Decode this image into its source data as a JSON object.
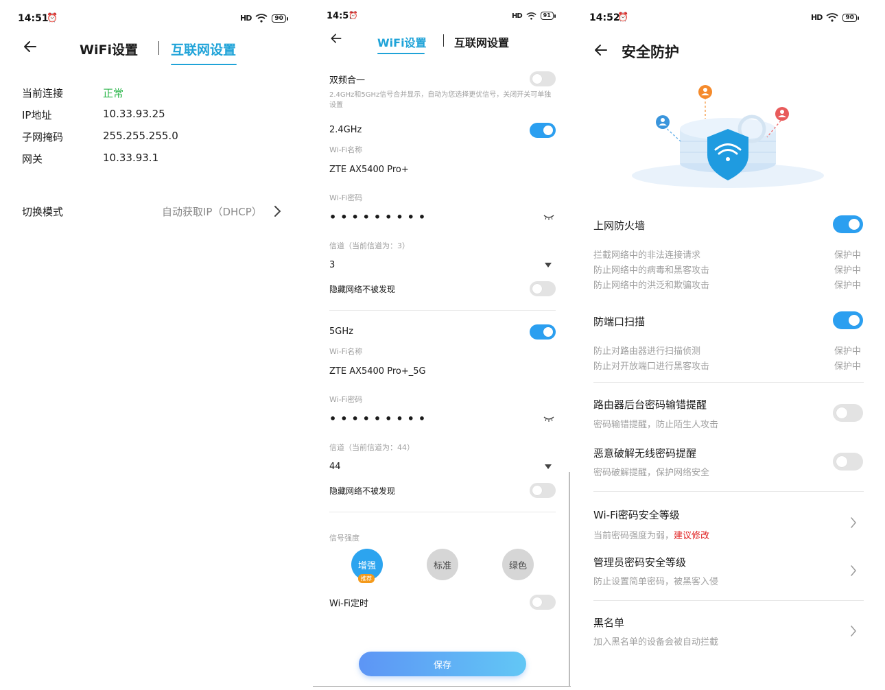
{
  "colors": {
    "accent": "#1fa3d8",
    "toggle_on": "#2b9ff0",
    "ok_green": "#2cb64b",
    "warn_red": "#e02020"
  },
  "p1": {
    "status": {
      "time": "14:51",
      "signal": "HD",
      "battery": "90"
    },
    "tabs": {
      "wifi": "WiFi设置",
      "internet": "互联网设置"
    },
    "info": [
      {
        "label": "当前连接",
        "value": "正常"
      },
      {
        "label": "IP地址",
        "value": "10.33.93.25"
      },
      {
        "label": "子网掩码",
        "value": "255.255.255.0"
      },
      {
        "label": "网关",
        "value": "10.33.93.1"
      }
    ],
    "mode": {
      "label": "切换模式",
      "value": "自动获取IP（DHCP）"
    }
  },
  "p2": {
    "status": {
      "time": "14:51",
      "signal": "HD",
      "battery": "91"
    },
    "tabs": {
      "wifi": "WiFi设置",
      "internet": "互联网设置"
    },
    "dual": {
      "label": "双频合一",
      "desc": "2.4GHz和5GHz信号合并显示，自动为您选择更优信号，关闭开关可单独设置",
      "enabled": false
    },
    "band24": {
      "label": "2.4GHz",
      "enabled": true,
      "name_label": "Wi-Fi名称",
      "name": "ZTE AX5400 Pro+",
      "pwd_label": "Wi-Fi密码",
      "pwd": "•••••••••",
      "channel_label": "信道（当前信道为：3）",
      "channel": "3",
      "hide_label": "隐藏网络不被发现",
      "hide": false
    },
    "band5": {
      "label": "5GHz",
      "enabled": true,
      "name_label": "Wi-Fi名称",
      "name": "ZTE AX5400 Pro+_5G",
      "pwd_label": "Wi-Fi密码",
      "pwd": "•••••••••",
      "channel_label": "信道（当前信道为：44）",
      "channel": "44",
      "hide_label": "隐藏网络不被发现",
      "hide": false
    },
    "strength": {
      "label": "信号强度",
      "options": [
        "增强",
        "标准",
        "绿色"
      ],
      "badge": "推荐",
      "selected": "增强"
    },
    "timer": {
      "label": "Wi-Fi定时",
      "enabled": false
    },
    "save_label": "保存"
  },
  "p3": {
    "status": {
      "time": "14:52",
      "signal": "HD",
      "battery": "90"
    },
    "title": "安全防护",
    "firewall": {
      "label": "上网防火墙",
      "enabled": true,
      "items": [
        {
          "text": "拦截网络中的非法连接请求",
          "status": "保护中"
        },
        {
          "text": "防止网络中的病毒和黑客攻击",
          "status": "保护中"
        },
        {
          "text": "防止网络中的洪泛和欺骗攻击",
          "status": "保护中"
        }
      ]
    },
    "portscan": {
      "label": "防端口扫描",
      "enabled": true,
      "items": [
        {
          "text": "防止对路由器进行扫描侦测",
          "status": "保护中"
        },
        {
          "text": "防止对开放端口进行黑客攻击",
          "status": "保护中"
        }
      ]
    },
    "pwd_alert": {
      "label": "路由器后台密码输错提醒",
      "desc": "密码输错提醒，防止陌生人攻击",
      "enabled": false
    },
    "crack_alert": {
      "label": "恶意破解无线密码提醒",
      "desc": "密码破解提醒，保护网络安全",
      "enabled": false
    },
    "wifi_level": {
      "label": "Wi-Fi密码安全等级",
      "desc": "当前密码强度为弱，",
      "link": "建议修改"
    },
    "admin_level": {
      "label": "管理员密码安全等级",
      "desc": "防止设置简单密码，被黑客入侵"
    },
    "blacklist": {
      "label": "黑名单",
      "desc": "加入黑名单的设备会被自动拦截"
    }
  }
}
